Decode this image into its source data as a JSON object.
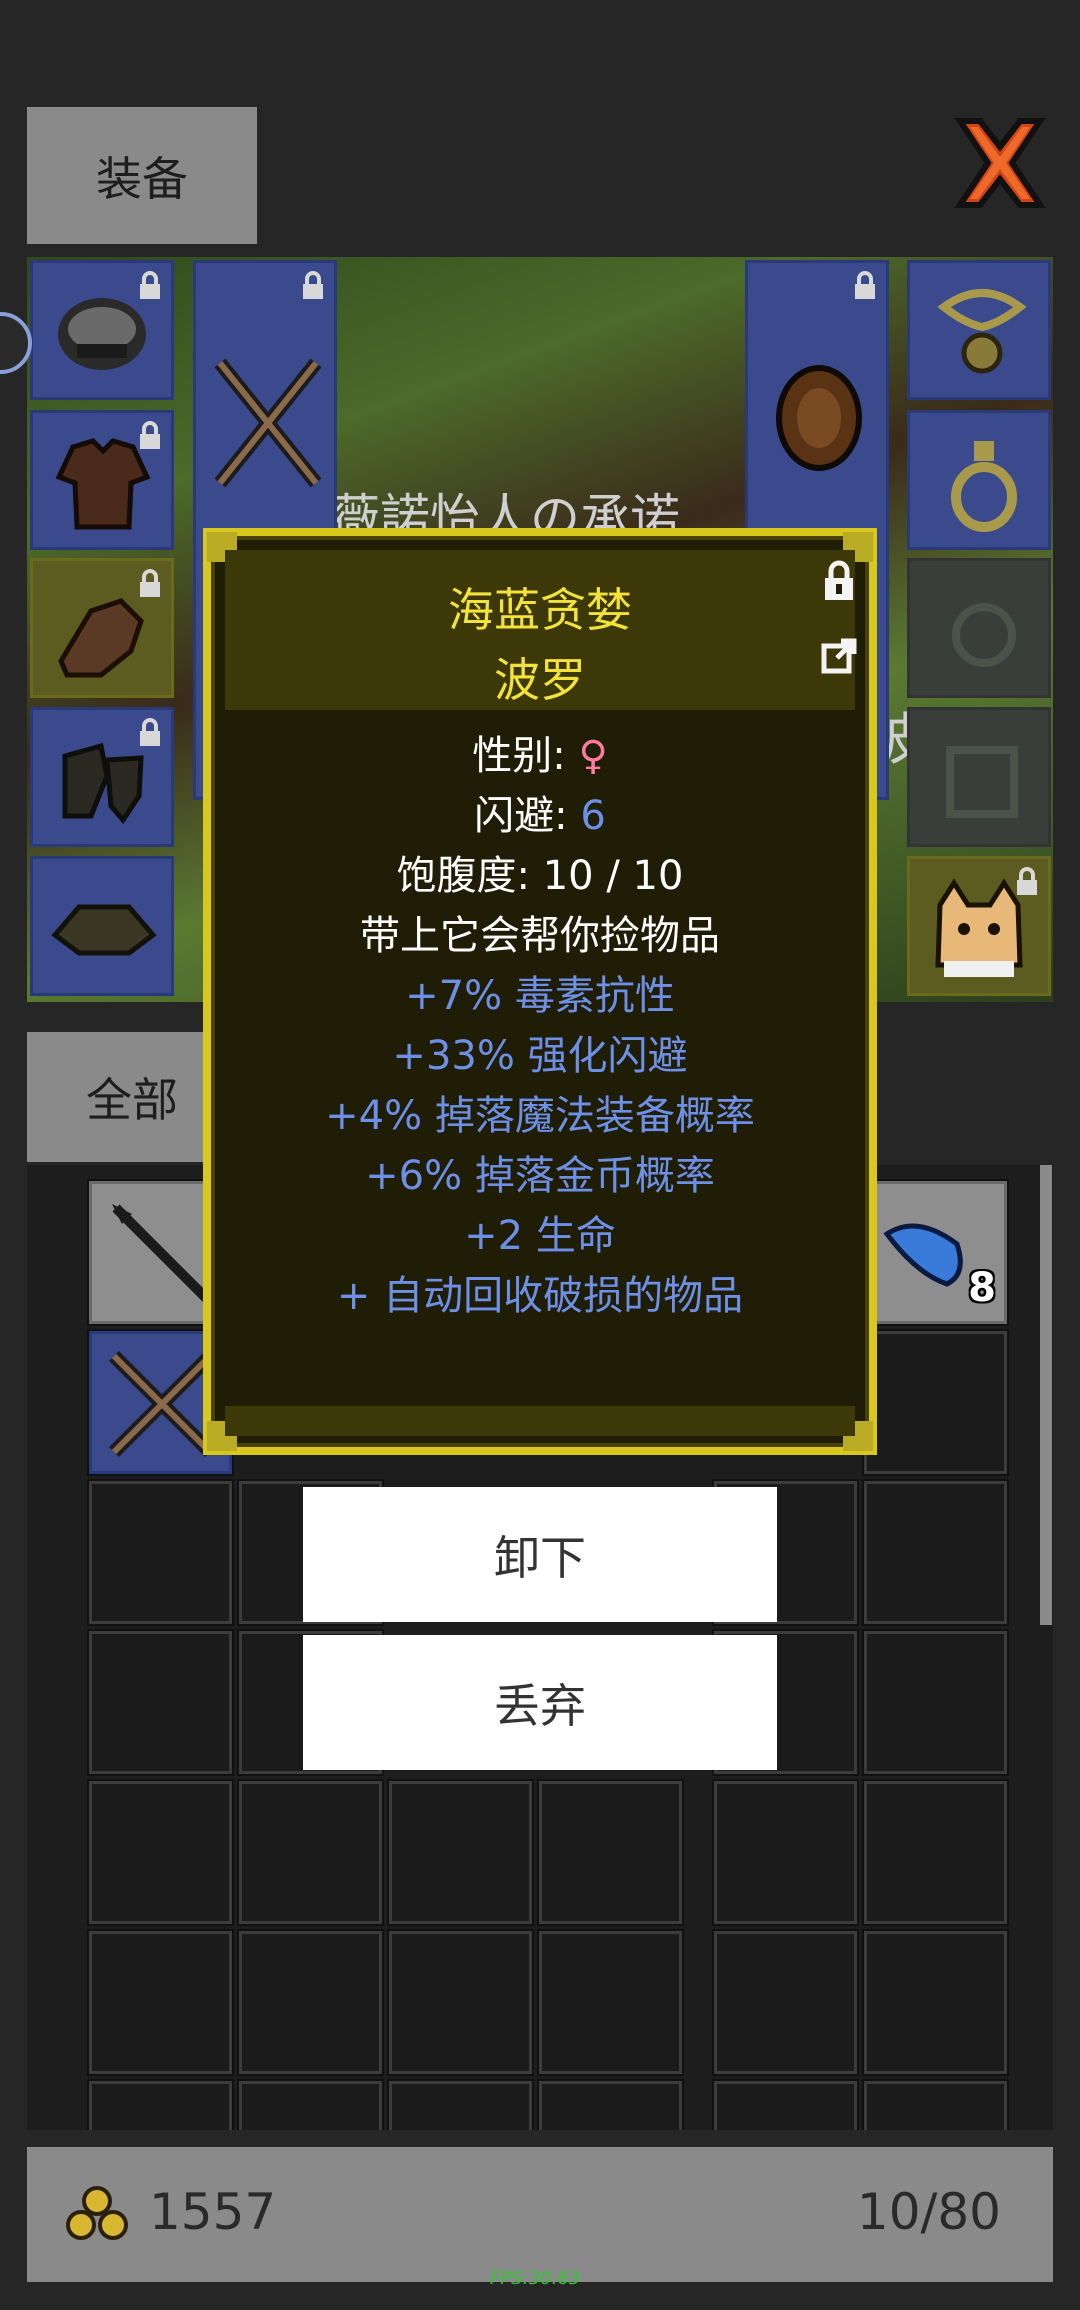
{
  "header": {
    "equip_tab": "装备"
  },
  "bag_tab": "全部",
  "popup": {
    "name_line1": "海蓝贪婪",
    "name_line2": "波罗",
    "gender_label": "性别: ",
    "gender_value": "♀",
    "evasion_label": "闪避: ",
    "evasion_value": "6",
    "satiety": "饱腹度: 10 / 10",
    "desc": "带上它会帮你捡物品",
    "bonuses": [
      "+7% 毒素抗性",
      "+33% 强化闪避",
      "+4% 掉落魔法装备概率",
      "+6% 掉落金币概率",
      "+2 生命",
      "+ 自动回收破损的物品"
    ]
  },
  "actions": {
    "unequip": "卸下",
    "drop": "丢弃"
  },
  "footer": {
    "gold": "1557",
    "capacity": "10/80"
  },
  "bag": {
    "stack_count": "8"
  },
  "scene_text_1": "薇諾怡人の承诺",
  "scene_text_2": "波",
  "fps": "FPS:30.63",
  "colors": {
    "accent_gold": "#d8c81e",
    "slot_blue": "#3a4a8c",
    "bonus_blue": "#6e8fe6",
    "female_pink": "#ff7aa0"
  }
}
